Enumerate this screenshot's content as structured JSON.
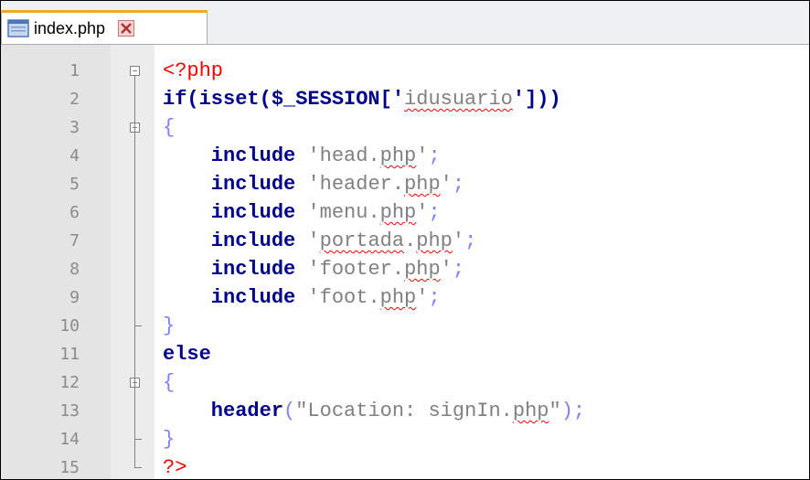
{
  "tab": {
    "label": "index.php",
    "file_icon": "file-icon",
    "close_icon": "close-icon"
  },
  "lines": [
    {
      "n": "1",
      "parts": [
        {
          "t": "<?php",
          "c": "php"
        }
      ],
      "fold": "box"
    },
    {
      "n": "2",
      "parts": [
        {
          "t": "if(isset($_SESSION['",
          "c": "kw"
        },
        {
          "t": "idusuario",
          "c": "str squig"
        },
        {
          "t": "']))",
          "c": "kw"
        }
      ]
    },
    {
      "n": "3",
      "parts": [
        {
          "t": "{",
          "c": "op"
        }
      ],
      "fold": "box"
    },
    {
      "n": "4",
      "parts": [
        {
          "t": "    include ",
          "c": "kw"
        },
        {
          "t": "'head.",
          "c": "str"
        },
        {
          "t": "php",
          "c": "str squig"
        },
        {
          "t": "'",
          "c": "str"
        },
        {
          "t": ";",
          "c": "op"
        }
      ]
    },
    {
      "n": "5",
      "parts": [
        {
          "t": "    include ",
          "c": "kw"
        },
        {
          "t": "'header.",
          "c": "str"
        },
        {
          "t": "php",
          "c": "str squig"
        },
        {
          "t": "'",
          "c": "str"
        },
        {
          "t": ";",
          "c": "op"
        }
      ]
    },
    {
      "n": "6",
      "parts": [
        {
          "t": "    include ",
          "c": "kw"
        },
        {
          "t": "'menu.",
          "c": "str"
        },
        {
          "t": "php",
          "c": "str squig"
        },
        {
          "t": "'",
          "c": "str"
        },
        {
          "t": ";",
          "c": "op"
        }
      ]
    },
    {
      "n": "7",
      "parts": [
        {
          "t": "    include ",
          "c": "kw"
        },
        {
          "t": "'",
          "c": "str"
        },
        {
          "t": "portada",
          "c": "str squig"
        },
        {
          "t": ".",
          "c": "str"
        },
        {
          "t": "php",
          "c": "str squig"
        },
        {
          "t": "'",
          "c": "str"
        },
        {
          "t": ";",
          "c": "op"
        }
      ]
    },
    {
      "n": "8",
      "parts": [
        {
          "t": "    include ",
          "c": "kw"
        },
        {
          "t": "'footer.",
          "c": "str"
        },
        {
          "t": "php",
          "c": "str squig"
        },
        {
          "t": "'",
          "c": "str"
        },
        {
          "t": ";",
          "c": "op"
        }
      ]
    },
    {
      "n": "9",
      "parts": [
        {
          "t": "    include ",
          "c": "kw"
        },
        {
          "t": "'foot.",
          "c": "str"
        },
        {
          "t": "php",
          "c": "str squig"
        },
        {
          "t": "'",
          "c": "str"
        },
        {
          "t": ";",
          "c": "op"
        }
      ]
    },
    {
      "n": "10",
      "parts": [
        {
          "t": "}",
          "c": "op"
        }
      ],
      "fold": "end"
    },
    {
      "n": "11",
      "parts": [
        {
          "t": "else",
          "c": "kw"
        }
      ]
    },
    {
      "n": "12",
      "parts": [
        {
          "t": "{",
          "c": "op"
        }
      ],
      "fold": "box"
    },
    {
      "n": "13",
      "parts": [
        {
          "t": "    header",
          "c": "fn"
        },
        {
          "t": "(",
          "c": "op"
        },
        {
          "t": "\"Location: signIn.",
          "c": "str"
        },
        {
          "t": "php",
          "c": "str squig"
        },
        {
          "t": "\"",
          "c": "str"
        },
        {
          "t": ");",
          "c": "op"
        }
      ]
    },
    {
      "n": "14",
      "parts": [
        {
          "t": "}",
          "c": "op"
        }
      ],
      "fold": "end"
    },
    {
      "n": "15",
      "parts": [
        {
          "t": "?>",
          "c": "php"
        }
      ],
      "fold": "end"
    }
  ]
}
